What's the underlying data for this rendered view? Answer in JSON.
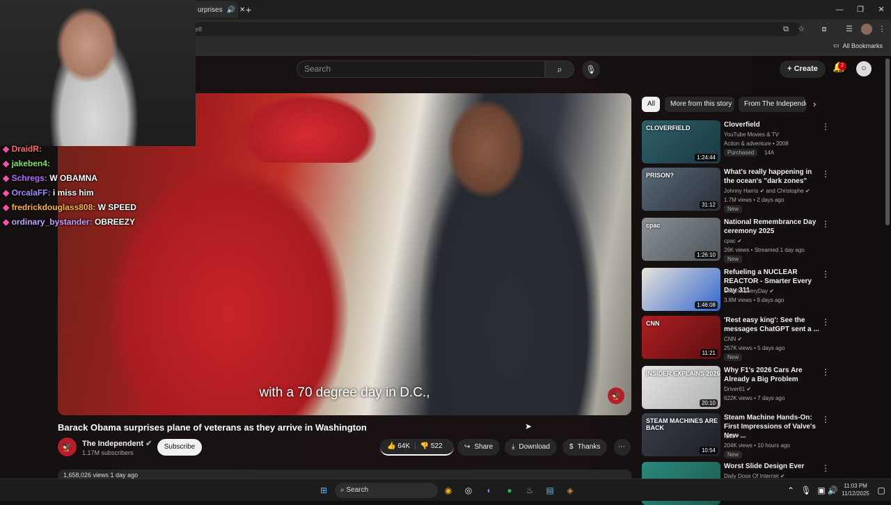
{
  "browser": {
    "tab_title": "urprises",
    "url_fragment": "e8",
    "all_bookmarks": "All Bookmarks"
  },
  "youtube": {
    "search_placeholder": "Search",
    "create_label": "Create",
    "notif_count": "2"
  },
  "video": {
    "caption": "with a 70 degree day in D.C.,",
    "title": "Barack Obama surprises plane of veterans as they arrive in Washington",
    "channel": "The Independent",
    "subscribers": "1.17M subscribers",
    "subscribe_label": "Subscribe",
    "likes": "64K",
    "dislikes": "522",
    "share_label": "Share",
    "download_label": "Download",
    "thanks_label": "Thanks",
    "views_line": "1,658,026 views  1 day ago"
  },
  "chat": [
    {
      "user": "DraidR:",
      "msg": "",
      "color": "#ff6b6b"
    },
    {
      "user": "jakeben4:",
      "msg": "",
      "color": "#7ee16b"
    },
    {
      "user": "Schregs:",
      "msg": "W OBAMNA",
      "color": "#b36bff"
    },
    {
      "user": "OrcalaFF:",
      "msg": "i miss him",
      "color": "#9b8cff"
    },
    {
      "user": "fredrickdouglass808:",
      "msg": "W SPEED",
      "color": "#ffb347"
    },
    {
      "user": "ordinary_bystander:",
      "msg": "OBREEZY",
      "color": "#c7a0ff"
    }
  ],
  "chips": [
    "All",
    "More from this story",
    "From The Independent"
  ],
  "recommendations": [
    {
      "title": "Cloverfield",
      "meta1": "YouTube Movies & TV",
      "meta2": "Action & adventure • 2008",
      "tag": "Purchased",
      "extra": "14A",
      "duration": "1:24:44",
      "thumb_text": "CLOVERFIELD",
      "color1": "#2f5f6a",
      "color2": "#1b3940"
    },
    {
      "title": "What's really happening in the ocean's \"dark zones\"",
      "meta1": "Johnny Harris ✔ and Christophe ✔",
      "meta2": "1.7M views • 2 days ago",
      "tag": "New",
      "duration": "31:12",
      "thumb_text": "PRISON?",
      "color1": "#5a6a7a",
      "color2": "#2a2f3a"
    },
    {
      "title": "National Remembrance Day ceremony 2025",
      "meta1": "cpac ✔",
      "meta2": "26K views • Streamed 1 day ago",
      "tag": "New",
      "duration": "1:26:10",
      "thumb_text": "cpac",
      "color1": "#8a9196",
      "color2": "#4d5459"
    },
    {
      "title": "Refueling a NUCLEAR REACTOR - Smarter Every Day 311",
      "meta1": "SmarterEveryDay ✔",
      "meta2": "3.8M views • 9 days ago",
      "tag": "",
      "duration": "1:46:08",
      "thumb_text": "",
      "color1": "#e8e4dc",
      "color2": "#3366cc"
    },
    {
      "title": "'Rest easy king': See the messages ChatGPT sent a ...",
      "meta1": "CNN ✔",
      "meta2": "257K views • 5 days ago",
      "tag": "New",
      "duration": "11:21",
      "thumb_text": "CNN",
      "color1": "#b01e22",
      "color2": "#5a1012"
    },
    {
      "title": "Why F1's 2026 Cars Are Already a Big Problem",
      "meta1": "Driver61 ✔",
      "meta2": "622K views • 7 days ago",
      "tag": "",
      "duration": "20:10",
      "thumb_text": "INSIDER EXPLAINS 2026",
      "color1": "#e5e5e5",
      "color2": "#b0b0b0"
    },
    {
      "title": "Steam Machine Hands-On: First Impressions of Valve's New ...",
      "meta1": "IGN ✔",
      "meta2": "204K views • 10 hours ago",
      "tag": "New",
      "duration": "10:54",
      "thumb_text": "STEAM MACHINES ARE BACK",
      "color1": "#3a3f4a",
      "color2": "#1c1f25"
    },
    {
      "title": "Worst Slide Design Ever",
      "meta1": "Daily Dose Of Internet ✔",
      "meta2": "",
      "tag": "",
      "duration": "",
      "thumb_text": "",
      "color1": "#2a8a7a",
      "color2": "#1e5a50"
    }
  ],
  "taskbar": {
    "search_label": "Search",
    "time": "11:03 PM",
    "date": "11/12/2025"
  }
}
